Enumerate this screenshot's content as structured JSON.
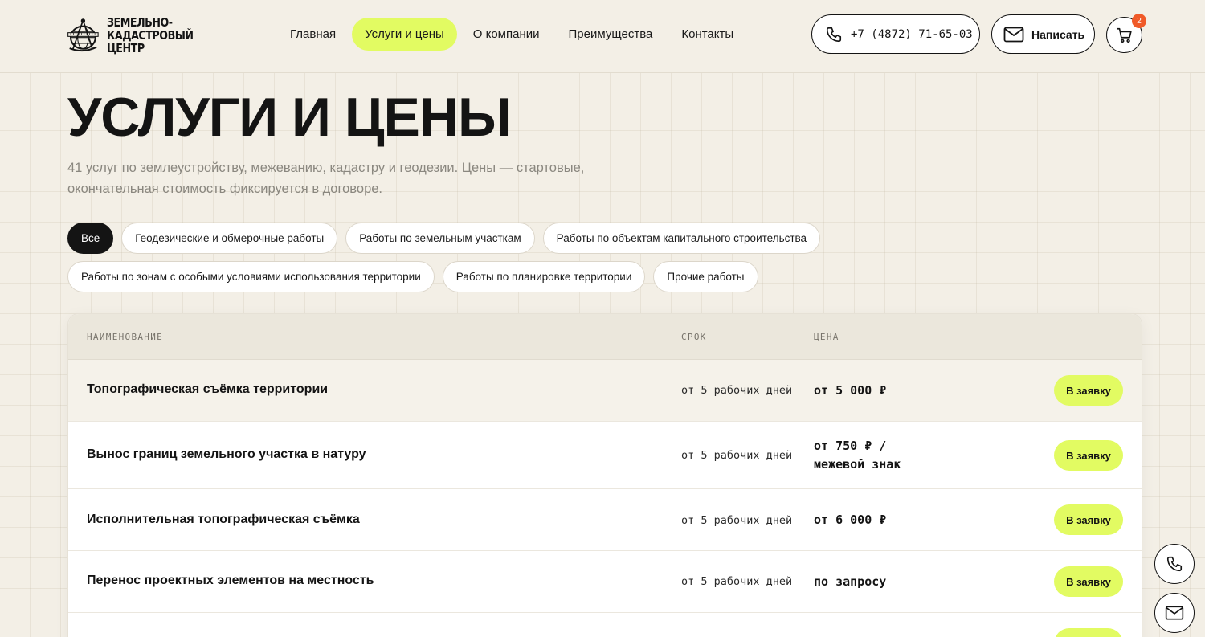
{
  "header": {
    "logo_lines": [
      "Земельно-",
      "кадастровый",
      "центр"
    ],
    "nav": [
      {
        "label": "Главная"
      },
      {
        "label": "Услуги и цены",
        "active": true
      },
      {
        "label": "О компании"
      },
      {
        "label": "Преимущества"
      },
      {
        "label": "Контакты"
      }
    ],
    "phone": "+7 (4872) 71-65-03",
    "write_label": "Написать",
    "cart_count": "2"
  },
  "hero": {
    "title": "УСЛУГИ И ЦЕНЫ",
    "lead": "41 услуг по землеустройству, межеванию, кадастру и геодезии. Цены — стартовые, окончательная стоимость фиксируется в договоре."
  },
  "filters": [
    {
      "label": "Все",
      "active": true
    },
    {
      "label": "Геодезические и обмерочные работы"
    },
    {
      "label": "Работы по земельным участкам"
    },
    {
      "label": "Работы по объектам капитального строительства"
    },
    {
      "label": "Работы по зонам с особыми условиями использования территории"
    },
    {
      "label": "Работы по планировке территории"
    },
    {
      "label": "Прочие работы"
    }
  ],
  "table": {
    "headers": {
      "name": "НАИМЕНОВАНИЕ",
      "term": "СРОК",
      "price": "ЦЕНА"
    },
    "order_label": "В заявку",
    "rows": [
      {
        "name": "Топографическая съёмка территории",
        "term": "от 5 рабочих дней",
        "price": "от 5 000 ₽"
      },
      {
        "name": "Вынос границ земельного участка в натуру",
        "term": "от 5 рабочих дней",
        "price": "от 750 ₽ /\nмежевой знак"
      },
      {
        "name": "Исполнительная топографическая съёмка",
        "term": "от 5 рабочих дней",
        "price": "от 6 000 ₽"
      },
      {
        "name": "Перенос проектных элементов на местность",
        "term": "от 5 рабочих дней",
        "price": "по запросу"
      }
    ]
  },
  "icons": {
    "phone": "phone-icon",
    "mail": "mail-icon",
    "cart": "cart-icon"
  },
  "colors": {
    "accent": "#e2fb62",
    "badge": "#f05a28",
    "ink": "#141414"
  }
}
